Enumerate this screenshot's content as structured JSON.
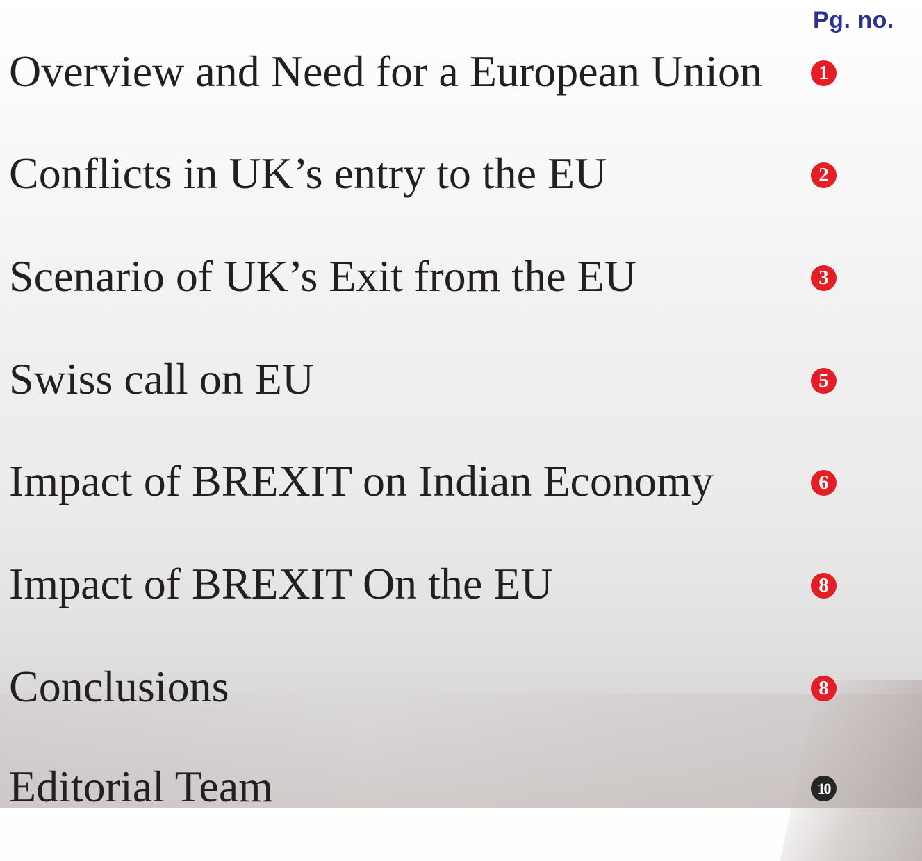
{
  "header": {
    "page_number_label": "Pg. no."
  },
  "colors": {
    "badge_red": "#e31e24",
    "badge_dark": "#262626",
    "header_blue": "#2e3192"
  },
  "toc": {
    "items": [
      {
        "title": "Overview and Need for a European Union",
        "page": "1",
        "badge_color": "#e31e24"
      },
      {
        "title": "Conflicts in UK’s entry to the EU",
        "page": "2",
        "badge_color": "#e31e24"
      },
      {
        "title": "Scenario of UK’s Exit from the EU",
        "page": "3",
        "badge_color": "#e31e24"
      },
      {
        "title": "Swiss call on EU",
        "page": "5",
        "badge_color": "#e31e24"
      },
      {
        "title": "Impact of BREXIT on Indian Economy",
        "page": "6",
        "badge_color": "#e31e24"
      },
      {
        "title": "Impact of BREXIT On the EU",
        "page": "8",
        "badge_color": "#e31e24"
      },
      {
        "title": "Conclusions",
        "page": "8",
        "badge_color": "#e31e24"
      },
      {
        "title": "Editorial Team",
        "page": "10",
        "badge_color": "#262626"
      }
    ]
  }
}
